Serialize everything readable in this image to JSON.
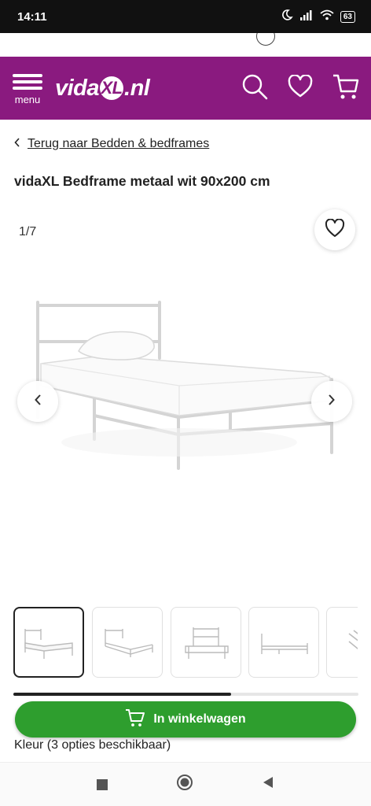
{
  "status_bar": {
    "time": "14:11",
    "battery": "63"
  },
  "header": {
    "menu_label": "menu",
    "logo_prefix": "vida",
    "logo_mark": "XL",
    "logo_suffix": ".nl",
    "brand_color": "#8a1a7f"
  },
  "breadcrumb": {
    "back_label": "Terug naar Bedden & bedframes"
  },
  "product": {
    "title": "vidaXL Bedframe metaal wit 90x200 cm",
    "image_counter": "1/7",
    "color_info": "Kleur (3 opties beschikbaar)"
  },
  "gallery": {
    "thumbnail_count": 5,
    "active_index": 0,
    "scroll_progress": 0.63
  },
  "cart_button": {
    "label": "In winkelwagen",
    "color": "#2e9e2e"
  },
  "icons": {
    "header": [
      "menu-icon",
      "search-icon",
      "heart-icon",
      "cart-icon"
    ],
    "gallery": [
      "chevron-left-icon",
      "chevron-right-icon",
      "heart-icon"
    ],
    "system_nav": [
      "recents-square-icon",
      "home-circle-icon",
      "back-triangle-icon"
    ]
  }
}
